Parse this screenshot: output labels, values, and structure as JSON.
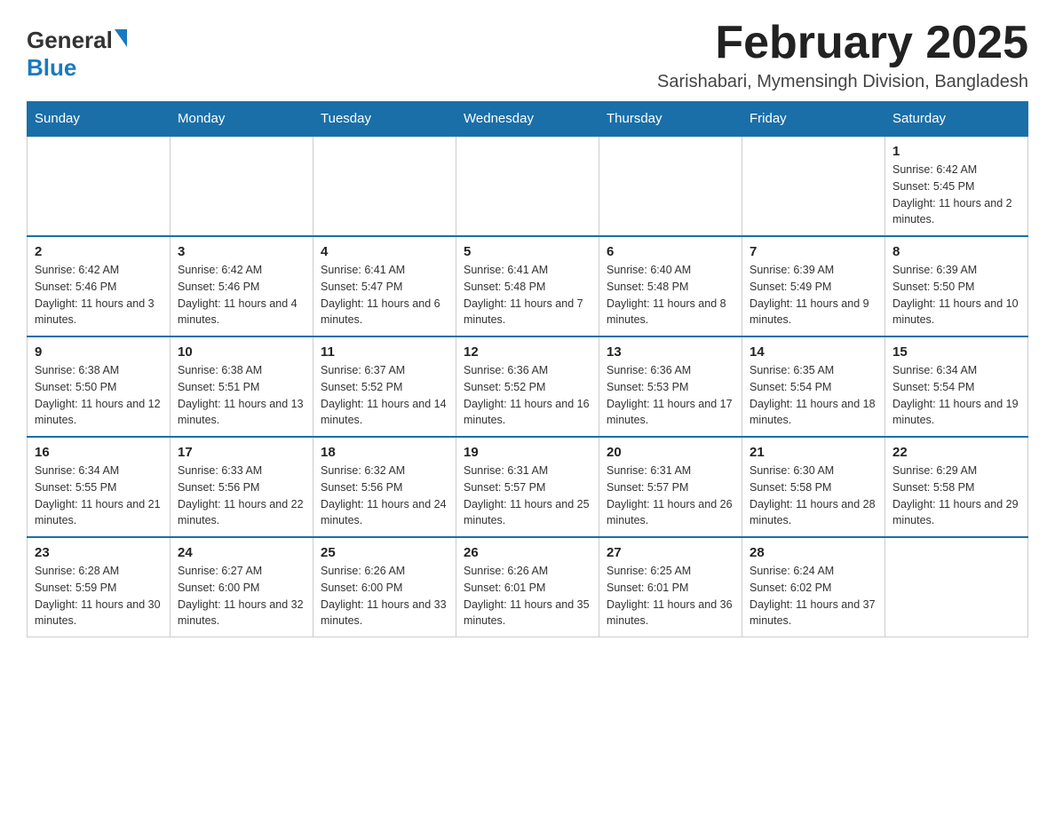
{
  "header": {
    "logo_general": "General",
    "logo_blue": "Blue",
    "month_title": "February 2025",
    "subtitle": "Sarishabari, Mymensingh Division, Bangladesh"
  },
  "weekdays": [
    "Sunday",
    "Monday",
    "Tuesday",
    "Wednesday",
    "Thursday",
    "Friday",
    "Saturday"
  ],
  "weeks": [
    [
      {
        "day": "",
        "sunrise": "",
        "sunset": "",
        "daylight": ""
      },
      {
        "day": "",
        "sunrise": "",
        "sunset": "",
        "daylight": ""
      },
      {
        "day": "",
        "sunrise": "",
        "sunset": "",
        "daylight": ""
      },
      {
        "day": "",
        "sunrise": "",
        "sunset": "",
        "daylight": ""
      },
      {
        "day": "",
        "sunrise": "",
        "sunset": "",
        "daylight": ""
      },
      {
        "day": "",
        "sunrise": "",
        "sunset": "",
        "daylight": ""
      },
      {
        "day": "1",
        "sunrise": "Sunrise: 6:42 AM",
        "sunset": "Sunset: 5:45 PM",
        "daylight": "Daylight: 11 hours and 2 minutes."
      }
    ],
    [
      {
        "day": "2",
        "sunrise": "Sunrise: 6:42 AM",
        "sunset": "Sunset: 5:46 PM",
        "daylight": "Daylight: 11 hours and 3 minutes."
      },
      {
        "day": "3",
        "sunrise": "Sunrise: 6:42 AM",
        "sunset": "Sunset: 5:46 PM",
        "daylight": "Daylight: 11 hours and 4 minutes."
      },
      {
        "day": "4",
        "sunrise": "Sunrise: 6:41 AM",
        "sunset": "Sunset: 5:47 PM",
        "daylight": "Daylight: 11 hours and 6 minutes."
      },
      {
        "day": "5",
        "sunrise": "Sunrise: 6:41 AM",
        "sunset": "Sunset: 5:48 PM",
        "daylight": "Daylight: 11 hours and 7 minutes."
      },
      {
        "day": "6",
        "sunrise": "Sunrise: 6:40 AM",
        "sunset": "Sunset: 5:48 PM",
        "daylight": "Daylight: 11 hours and 8 minutes."
      },
      {
        "day": "7",
        "sunrise": "Sunrise: 6:39 AM",
        "sunset": "Sunset: 5:49 PM",
        "daylight": "Daylight: 11 hours and 9 minutes."
      },
      {
        "day": "8",
        "sunrise": "Sunrise: 6:39 AM",
        "sunset": "Sunset: 5:50 PM",
        "daylight": "Daylight: 11 hours and 10 minutes."
      }
    ],
    [
      {
        "day": "9",
        "sunrise": "Sunrise: 6:38 AM",
        "sunset": "Sunset: 5:50 PM",
        "daylight": "Daylight: 11 hours and 12 minutes."
      },
      {
        "day": "10",
        "sunrise": "Sunrise: 6:38 AM",
        "sunset": "Sunset: 5:51 PM",
        "daylight": "Daylight: 11 hours and 13 minutes."
      },
      {
        "day": "11",
        "sunrise": "Sunrise: 6:37 AM",
        "sunset": "Sunset: 5:52 PM",
        "daylight": "Daylight: 11 hours and 14 minutes."
      },
      {
        "day": "12",
        "sunrise": "Sunrise: 6:36 AM",
        "sunset": "Sunset: 5:52 PM",
        "daylight": "Daylight: 11 hours and 16 minutes."
      },
      {
        "day": "13",
        "sunrise": "Sunrise: 6:36 AM",
        "sunset": "Sunset: 5:53 PM",
        "daylight": "Daylight: 11 hours and 17 minutes."
      },
      {
        "day": "14",
        "sunrise": "Sunrise: 6:35 AM",
        "sunset": "Sunset: 5:54 PM",
        "daylight": "Daylight: 11 hours and 18 minutes."
      },
      {
        "day": "15",
        "sunrise": "Sunrise: 6:34 AM",
        "sunset": "Sunset: 5:54 PM",
        "daylight": "Daylight: 11 hours and 19 minutes."
      }
    ],
    [
      {
        "day": "16",
        "sunrise": "Sunrise: 6:34 AM",
        "sunset": "Sunset: 5:55 PM",
        "daylight": "Daylight: 11 hours and 21 minutes."
      },
      {
        "day": "17",
        "sunrise": "Sunrise: 6:33 AM",
        "sunset": "Sunset: 5:56 PM",
        "daylight": "Daylight: 11 hours and 22 minutes."
      },
      {
        "day": "18",
        "sunrise": "Sunrise: 6:32 AM",
        "sunset": "Sunset: 5:56 PM",
        "daylight": "Daylight: 11 hours and 24 minutes."
      },
      {
        "day": "19",
        "sunrise": "Sunrise: 6:31 AM",
        "sunset": "Sunset: 5:57 PM",
        "daylight": "Daylight: 11 hours and 25 minutes."
      },
      {
        "day": "20",
        "sunrise": "Sunrise: 6:31 AM",
        "sunset": "Sunset: 5:57 PM",
        "daylight": "Daylight: 11 hours and 26 minutes."
      },
      {
        "day": "21",
        "sunrise": "Sunrise: 6:30 AM",
        "sunset": "Sunset: 5:58 PM",
        "daylight": "Daylight: 11 hours and 28 minutes."
      },
      {
        "day": "22",
        "sunrise": "Sunrise: 6:29 AM",
        "sunset": "Sunset: 5:58 PM",
        "daylight": "Daylight: 11 hours and 29 minutes."
      }
    ],
    [
      {
        "day": "23",
        "sunrise": "Sunrise: 6:28 AM",
        "sunset": "Sunset: 5:59 PM",
        "daylight": "Daylight: 11 hours and 30 minutes."
      },
      {
        "day": "24",
        "sunrise": "Sunrise: 6:27 AM",
        "sunset": "Sunset: 6:00 PM",
        "daylight": "Daylight: 11 hours and 32 minutes."
      },
      {
        "day": "25",
        "sunrise": "Sunrise: 6:26 AM",
        "sunset": "Sunset: 6:00 PM",
        "daylight": "Daylight: 11 hours and 33 minutes."
      },
      {
        "day": "26",
        "sunrise": "Sunrise: 6:26 AM",
        "sunset": "Sunset: 6:01 PM",
        "daylight": "Daylight: 11 hours and 35 minutes."
      },
      {
        "day": "27",
        "sunrise": "Sunrise: 6:25 AM",
        "sunset": "Sunset: 6:01 PM",
        "daylight": "Daylight: 11 hours and 36 minutes."
      },
      {
        "day": "28",
        "sunrise": "Sunrise: 6:24 AM",
        "sunset": "Sunset: 6:02 PM",
        "daylight": "Daylight: 11 hours and 37 minutes."
      },
      {
        "day": "",
        "sunrise": "",
        "sunset": "",
        "daylight": ""
      }
    ]
  ]
}
